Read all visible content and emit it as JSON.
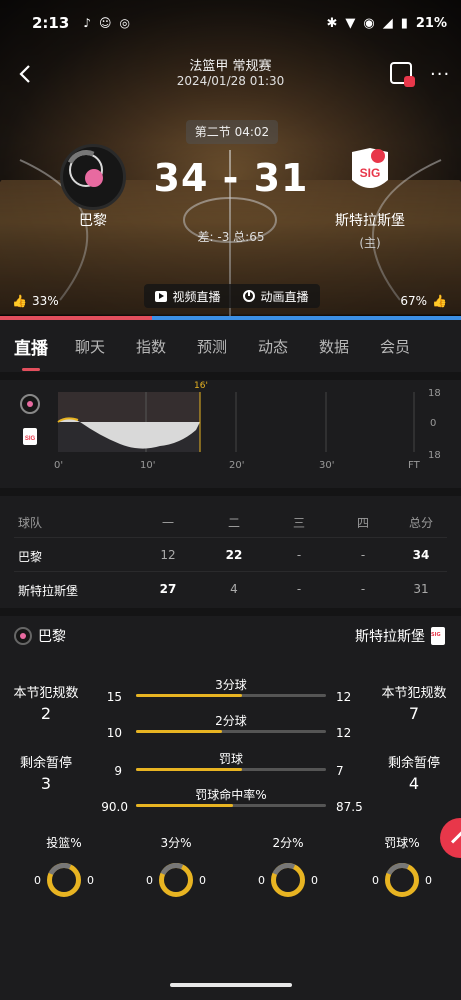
{
  "status": {
    "time": "2:13",
    "battery": "21%",
    "app_icons": [
      "tiktok-icon",
      "baby-icon",
      "instagram-icon"
    ]
  },
  "header": {
    "league": "法篮甲 常规赛",
    "datetime": "2024/01/28 01:30",
    "period": "第二节 04:02",
    "score": "34 - 31",
    "diff": "差: -3 总:65"
  },
  "home": {
    "name": "巴黎",
    "support_pct": "33%",
    "support_fraction": 0.33
  },
  "away": {
    "name": "斯特拉斯堡",
    "tag": "(主)",
    "support_pct": "67%",
    "logo_text": "SIG"
  },
  "live": {
    "video_label": "视频直播",
    "anim_label": "动画直播"
  },
  "tabs": [
    "直播",
    "聊天",
    "指数",
    "预测",
    "动态",
    "数据",
    "会员"
  ],
  "momentum": {
    "marker": "16'",
    "x_ticks": [
      "0'",
      "10'",
      "20'",
      "30'",
      "FT"
    ],
    "y_labels": [
      "18",
      "0",
      "18"
    ]
  },
  "score_table": {
    "headers": [
      "球队",
      "一",
      "二",
      "三",
      "四",
      "总分"
    ],
    "rows": [
      {
        "team": "巴黎",
        "q": [
          "12",
          "22",
          "-",
          "-"
        ],
        "total": "34"
      },
      {
        "team": "斯特拉斯堡",
        "q": [
          "27",
          "4",
          "-",
          "-"
        ],
        "total": "31"
      }
    ]
  },
  "compare": {
    "home_team": "巴黎",
    "away_team": "斯特拉斯堡",
    "home_fouls_label": "本节犯规数",
    "home_fouls": "2",
    "away_fouls_label": "本节犯规数",
    "away_fouls": "7",
    "home_timeouts_label": "剩余暂停",
    "home_timeouts": "3",
    "away_timeouts_label": "剩余暂停",
    "away_timeouts": "4",
    "stats": [
      {
        "name": "3分球",
        "home": "15",
        "away": "12",
        "home_fraction": 0.56
      },
      {
        "name": "2分球",
        "home": "10",
        "away": "12",
        "home_fraction": 0.45
      },
      {
        "name": "罚球",
        "home": "9",
        "away": "7",
        "home_fraction": 0.56
      },
      {
        "name": "罚球命中率%",
        "home": "90.0",
        "away": "87.5",
        "home_fraction": 0.51
      }
    ],
    "rings": [
      {
        "name": "投篮%",
        "home": "0",
        "away": "0"
      },
      {
        "name": "3分%",
        "home": "0",
        "away": "0"
      },
      {
        "name": "2分%",
        "home": "0",
        "away": "0"
      },
      {
        "name": "罚球%",
        "home": "0",
        "away": "0"
      }
    ]
  },
  "colors": {
    "home": "#e24f5d",
    "away": "#3c8fe4",
    "accent": "#e8b422"
  }
}
